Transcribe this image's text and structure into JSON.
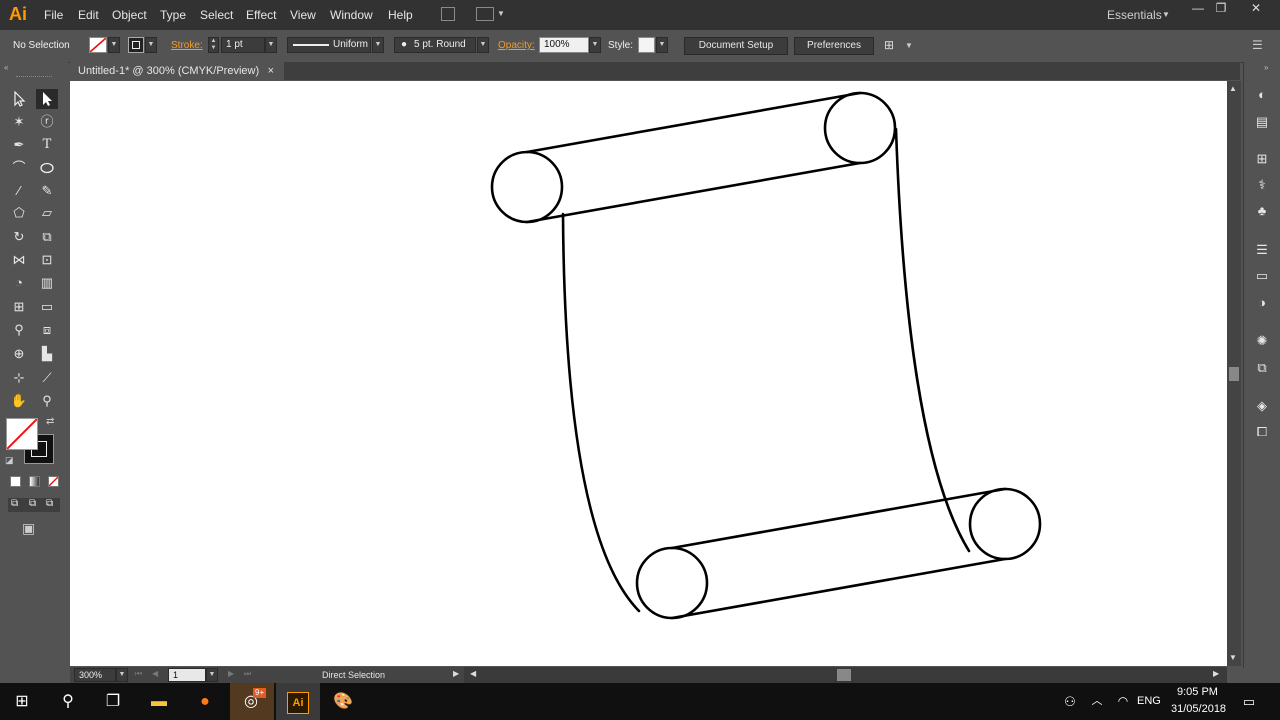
{
  "app": {
    "logo": "Ai",
    "workspace": "Essentials"
  },
  "menu": [
    "File",
    "Edit",
    "Object",
    "Type",
    "Select",
    "Effect",
    "View",
    "Window",
    "Help"
  ],
  "control_bar": {
    "selection_status": "No Selection",
    "stroke_label": "Stroke:",
    "stroke_weight": "1 pt",
    "profile": "Uniform",
    "brush": "5 pt. Round",
    "opacity_label": "Opacity:",
    "opacity": "100%",
    "style_label": "Style:",
    "document_setup": "Document Setup",
    "preferences": "Preferences"
  },
  "document": {
    "tab_title": "Untitled-1* @ 300% (CMYK/Preview)",
    "close": "×"
  },
  "status_bar": {
    "zoom": "300%",
    "artboard": "1",
    "current_tool": "Direct Selection"
  },
  "taskbar": {
    "time": "9:05 PM",
    "date": "31/05/2018",
    "language": "ENG",
    "badge": "9+"
  },
  "colors": {
    "accent_orange": "#f29b2c",
    "ai_logo": "#ff9a00",
    "canvas": "#ffffff",
    "ui_dark": "#323232",
    "ui_mid": "#535353"
  }
}
